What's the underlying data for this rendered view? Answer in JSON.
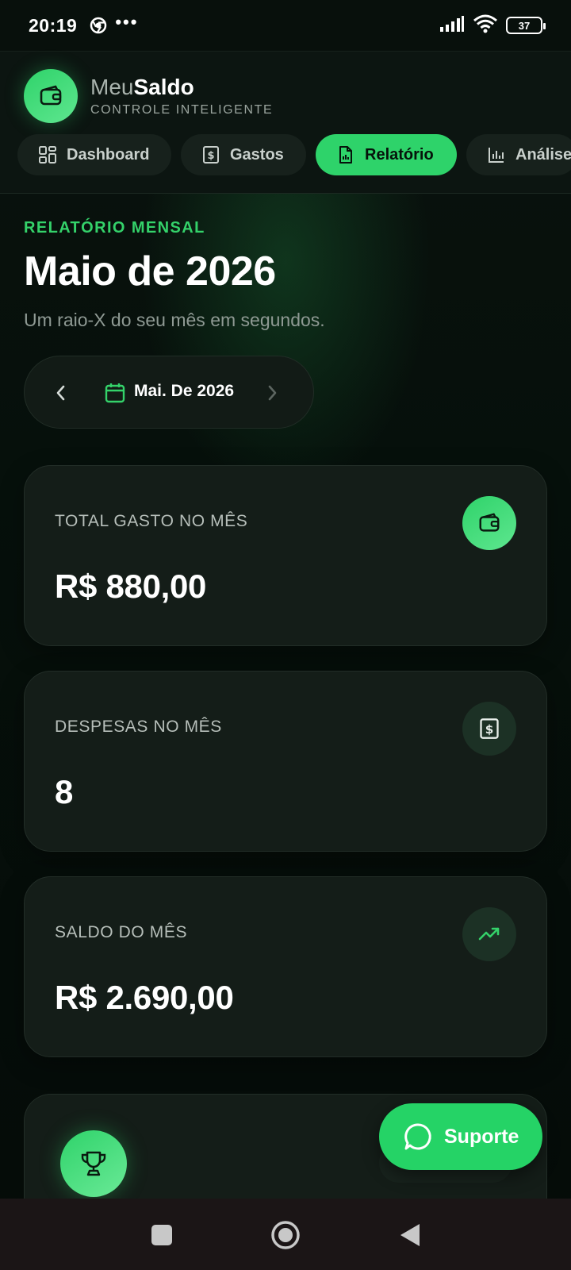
{
  "status_bar": {
    "time": "20:19",
    "dots": "•••",
    "battery": "37",
    "icons": [
      "chrome-icon",
      "signal-icon",
      "wifi-icon",
      "battery-icon"
    ]
  },
  "header": {
    "brand_light": "Meu",
    "brand_bold": "Saldo",
    "tagline": "CONTROLE INTELIGENTE",
    "brand_icon": "wallet-icon"
  },
  "nav": {
    "tabs": [
      {
        "label": "Dashboard",
        "icon": "dashboard-icon",
        "active": false
      },
      {
        "label": "Gastos",
        "icon": "receipt-icon",
        "active": false
      },
      {
        "label": "Relatório",
        "icon": "report-icon",
        "active": true
      },
      {
        "label": "Análise",
        "icon": "bar-chart-icon",
        "active": false
      }
    ]
  },
  "page": {
    "eyebrow": "RELATÓRIO MENSAL",
    "title": "Maio de 2026",
    "subtitle": "Um raio-X do seu mês em segundos.",
    "month_selector": "Mai. De 2026"
  },
  "cards": [
    {
      "label": "TOTAL GASTO NO MÊS",
      "value": "R$ 880,00",
      "icon": "wallet-icon"
    },
    {
      "label": "DESPESAS NO MÊS",
      "value": "8",
      "icon": "receipt-icon"
    },
    {
      "label": "SALDO DO MÊS",
      "value": "R$ 2.690,00",
      "icon": "trending-up-icon"
    }
  ],
  "partial_card": {
    "icon": "trophy-icon"
  },
  "support": {
    "label": "Suporte",
    "icon": "chat-bubble-icon"
  },
  "colors": {
    "accent": "#2ed36a",
    "background": "#050b08",
    "card": "#141d18",
    "support": "#25d366"
  }
}
